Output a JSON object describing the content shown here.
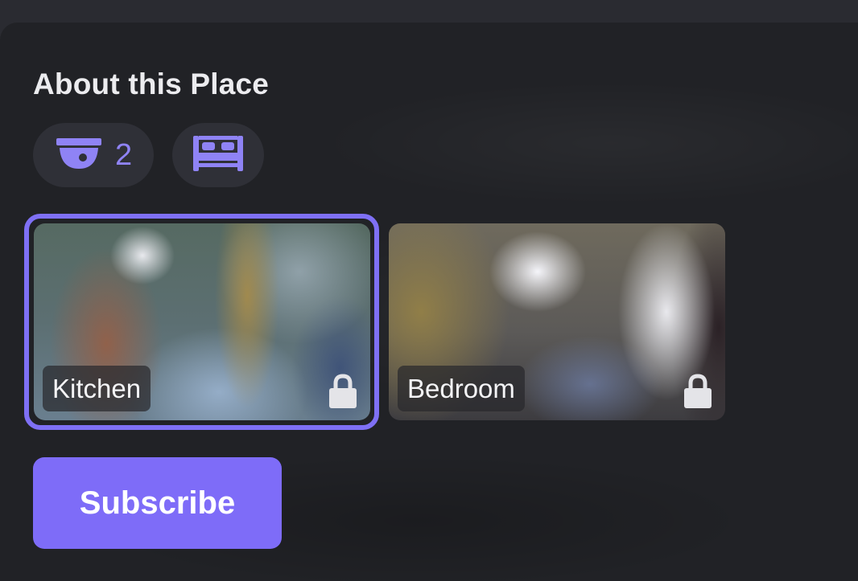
{
  "section": {
    "title": "About this Place"
  },
  "amenities": [
    {
      "icon": "security-camera-icon",
      "count": "2"
    },
    {
      "icon": "bed-icon"
    }
  ],
  "rooms": [
    {
      "label": "Kitchen",
      "icon": "lock-icon",
      "selected": true
    },
    {
      "label": "Bedroom",
      "icon": "lock-icon",
      "selected": false
    }
  ],
  "actions": {
    "subscribe_label": "Subscribe"
  },
  "colors": {
    "accent": "#7e6cf8",
    "panel": "#212226",
    "chip": "#2f3037"
  }
}
